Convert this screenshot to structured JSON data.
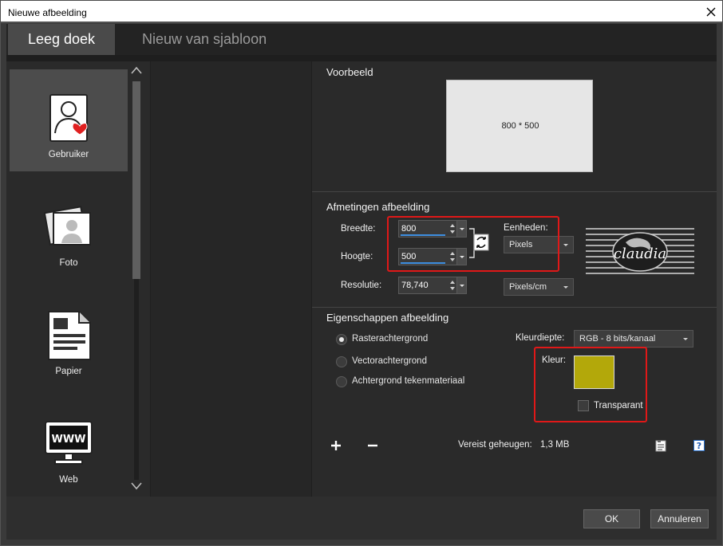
{
  "window": {
    "title": "Nieuwe afbeelding"
  },
  "tabs": [
    {
      "label": "Leeg doek"
    },
    {
      "label": "Nieuw van sjabloon"
    }
  ],
  "presets": [
    {
      "label": "Gebruiker",
      "icon": "user-heart-icon"
    },
    {
      "label": "Foto",
      "icon": "photo-icon"
    },
    {
      "label": "Papier",
      "icon": "document-icon"
    },
    {
      "label": "Web",
      "icon": "www-monitor-icon"
    }
  ],
  "preview": {
    "title": "Voorbeeld",
    "size_text": "800 * 500"
  },
  "dimensions": {
    "title": "Afmetingen afbeelding",
    "width_label": "Breedte:",
    "width_value": "800",
    "height_label": "Hoogte:",
    "height_value": "500",
    "resolution_label": "Resolutie:",
    "resolution_value": "78,740",
    "units_label": "Eenheden:",
    "units_value": "Pixels",
    "resolution_units_value": "Pixels/cm"
  },
  "properties": {
    "title": "Eigenschappen afbeelding",
    "options": [
      {
        "label": "Rasterachtergrond",
        "selected": true
      },
      {
        "label": "Vectorachtergrond",
        "selected": false
      },
      {
        "label": "Achtergrond tekenmateriaal",
        "selected": false
      }
    ],
    "color_depth_label": "Kleurdiepte:",
    "color_depth_value": "RGB - 8 bits/kanaal",
    "color_label": "Kleur:",
    "color_value": "#b3a80a",
    "transparent_label": "Transparant",
    "transparent_checked": false
  },
  "memory": {
    "label": "Vereist geheugen:",
    "value": "1,3 MB"
  },
  "buttons": {
    "ok": "OK",
    "cancel": "Annuleren"
  },
  "colors": {
    "highlight": "#e01818",
    "accent": "#3d8ee0"
  }
}
